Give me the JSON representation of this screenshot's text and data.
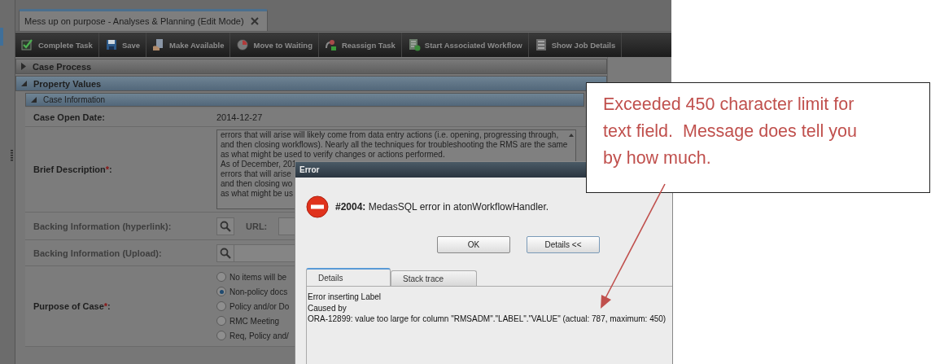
{
  "tab": {
    "title": "Mess up on purpose - Analyses & Planning (Edit Mode)",
    "selected": true
  },
  "toolbar": [
    {
      "label": "Complete Task"
    },
    {
      "label": "Save"
    },
    {
      "label": "Make Available"
    },
    {
      "label": "Move to Waiting"
    },
    {
      "label": "Reassign Task"
    },
    {
      "label": "Start Associated Workflow"
    },
    {
      "label": "Show Job Details"
    }
  ],
  "sections": [
    {
      "title": "Case Process",
      "expanded": false,
      "kind": "group"
    },
    {
      "title": "Property Values",
      "expanded": true,
      "kind": "group"
    },
    {
      "title": "Case Information",
      "expanded": true,
      "kind": "sub"
    }
  ],
  "form": [
    {
      "kind": "text",
      "label": "Case Open Date:",
      "value": "2014-12-27"
    },
    {
      "kind": "textarea",
      "label": "Brief Description",
      "required_mark": "*",
      "label_end": ":",
      "lines": [
        "errors that will arise will likely come from data entry actions (i.e. opening, progressing through,",
        "and then closing workflows).  Nearly all the techniques for troubleshooting the RMS are the same",
        "as what might be used to verify changes or actions performed.",
        "As of December, 201",
        "errors that will arise",
        "and then closing wo",
        "as what might be us"
      ]
    },
    {
      "kind": "link",
      "label": "Backing Information (hyperlink):",
      "disabled": true,
      "url_label": "URL:"
    },
    {
      "kind": "upload",
      "label": "Backing Information (Upload):",
      "disabled": true
    },
    {
      "kind": "radio",
      "label": "Purpose of Case",
      "required_mark": "*",
      "label_end": ":",
      "options": [
        {
          "label": "No items will be",
          "selected": false
        },
        {
          "label": "Non-policy docs",
          "selected": true
        },
        {
          "label": "Policy and/or Do",
          "selected": false
        },
        {
          "label": "RMC Meeting",
          "selected": false
        },
        {
          "label": "Req, Policy and/",
          "selected": false
        }
      ]
    }
  ],
  "dialog": {
    "title": "Error",
    "code": "#2004:",
    "message": "MedasSQL error in atonWorkflowHandler.",
    "buttons": [
      "OK",
      "Details <<"
    ],
    "tabs": [
      {
        "label": "Details",
        "selected": true
      },
      {
        "label": "Stack trace",
        "selected": false
      }
    ],
    "details": [
      "Error inserting Label",
      "Caused by",
      "ORA-12899: value too large for column \"RMSADM\".\"LABEL\".\"VALUE\" (actual: 787, maximum: 450)"
    ]
  },
  "callout": {
    "text": "Exceeded 450 character limit for text field.  Message does tell you by how much."
  }
}
